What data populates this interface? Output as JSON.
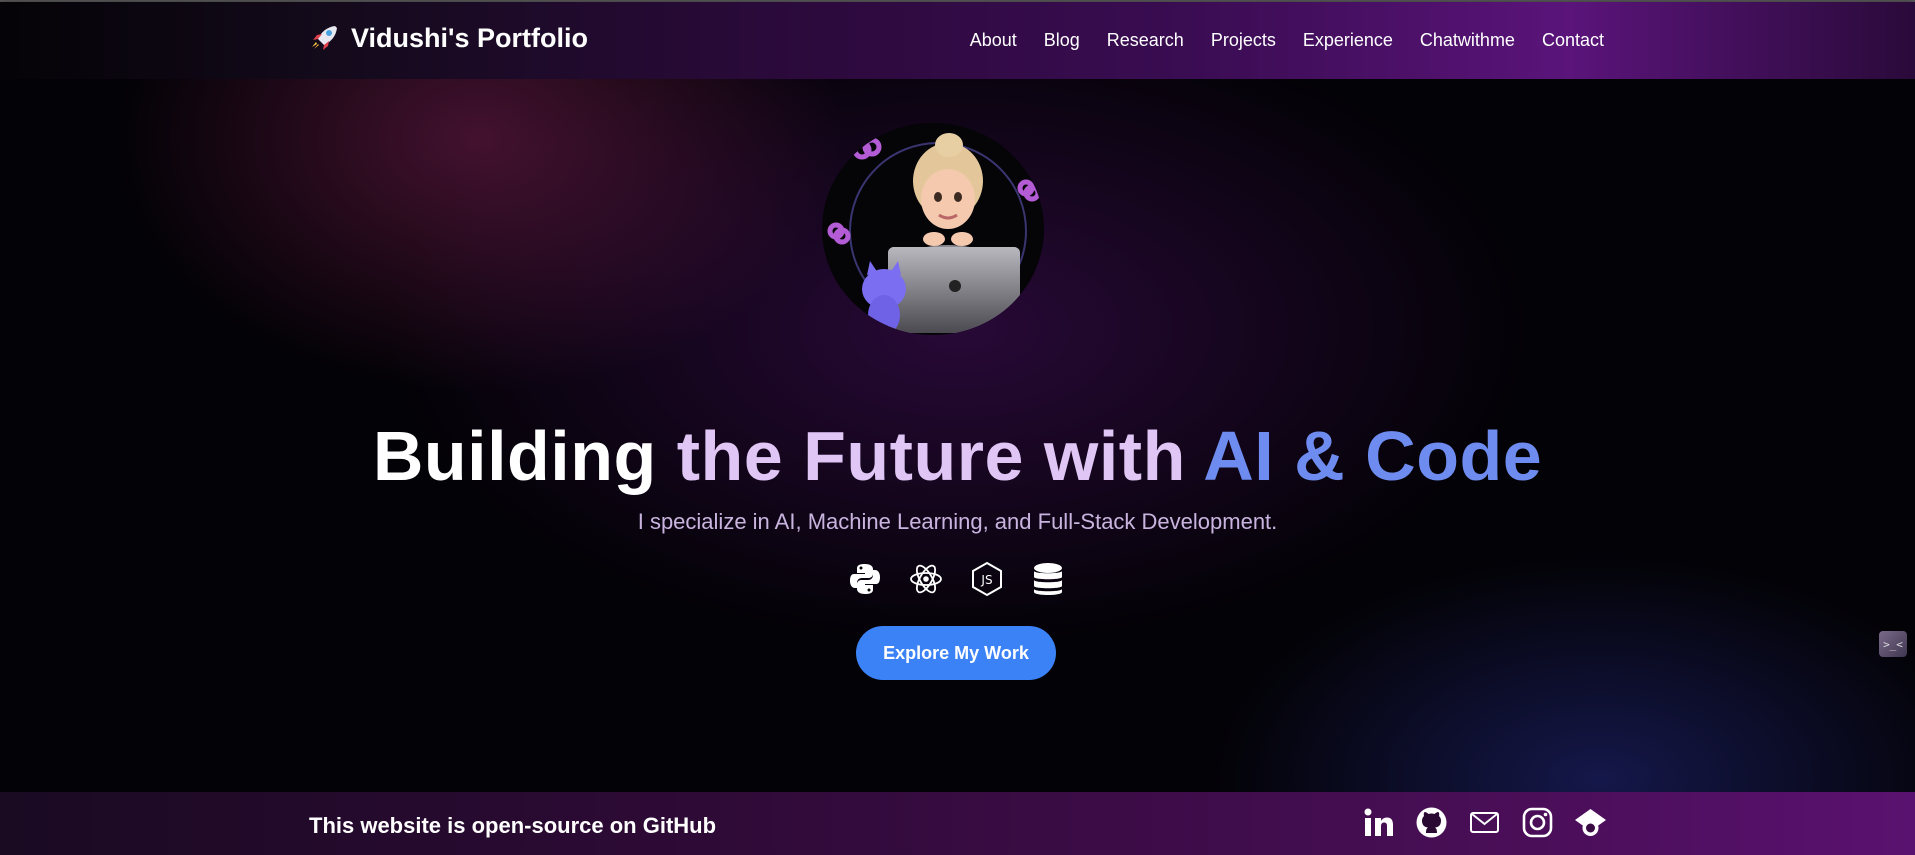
{
  "nav": {
    "brand": "Vidushi's Portfolio",
    "brand_icon": "rocket-icon",
    "links": [
      "About",
      "Blog",
      "Research",
      "Projects",
      "Experience",
      "Chatwithme",
      "Contact"
    ]
  },
  "hero": {
    "title_part1": "Building ",
    "title_part2": "the Future with ",
    "title_part3": "AI & Code",
    "subtitle": "I specialize in AI, Machine Learning, and Full-Stack Development.",
    "tech_icons": [
      "python-icon",
      "react-icon",
      "nodejs-icon",
      "database-icon"
    ],
    "cta": "Explore My Work"
  },
  "footer": {
    "text": "This website is open-source on GitHub",
    "social_icons": [
      "linkedin-icon",
      "github-icon",
      "mail-icon",
      "instagram-icon",
      "scholar-icon"
    ]
  },
  "colors": {
    "accent_blue": "#3b82f6",
    "title_highlight": "#6e8bef",
    "title_light": "#e0c6f5",
    "nav_purple": "#5a147a"
  }
}
